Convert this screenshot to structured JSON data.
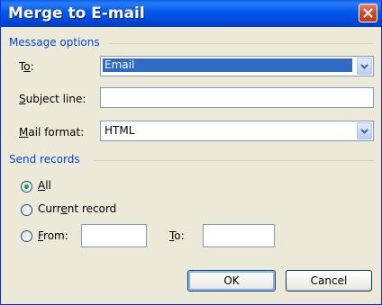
{
  "window": {
    "title": "Merge to E-mail"
  },
  "message_options": {
    "group_title": "Message options",
    "to": {
      "label_pre": "T",
      "label_key": "o",
      "label_post": ":",
      "value": "Email"
    },
    "subject": {
      "label_pre": "",
      "label_key": "S",
      "label_post": "ubject line:",
      "value": ""
    },
    "format": {
      "label_pre": "",
      "label_key": "M",
      "label_post": "ail format:",
      "value": "HTML"
    }
  },
  "send_records": {
    "group_title": "Send records",
    "all": {
      "label_pre": "",
      "label_key": "A",
      "label_post": "ll",
      "selected": true
    },
    "current": {
      "label_pre": "Curr",
      "label_key": "e",
      "label_post": "nt record",
      "selected": false
    },
    "from": {
      "label_pre": "",
      "label_key": "F",
      "label_post": "rom:",
      "value": ""
    },
    "to": {
      "label_pre": "",
      "label_key": "T",
      "label_post": "o:",
      "value": ""
    }
  },
  "buttons": {
    "ok": "OK",
    "cancel": "Cancel"
  },
  "icons": {
    "close": "close-icon",
    "dropdown": "chevron-down-icon"
  },
  "colors": {
    "titlebar": "#0054e3",
    "group_title": "#0046d5",
    "close": "#d04a25",
    "selection": "#316ac5"
  }
}
